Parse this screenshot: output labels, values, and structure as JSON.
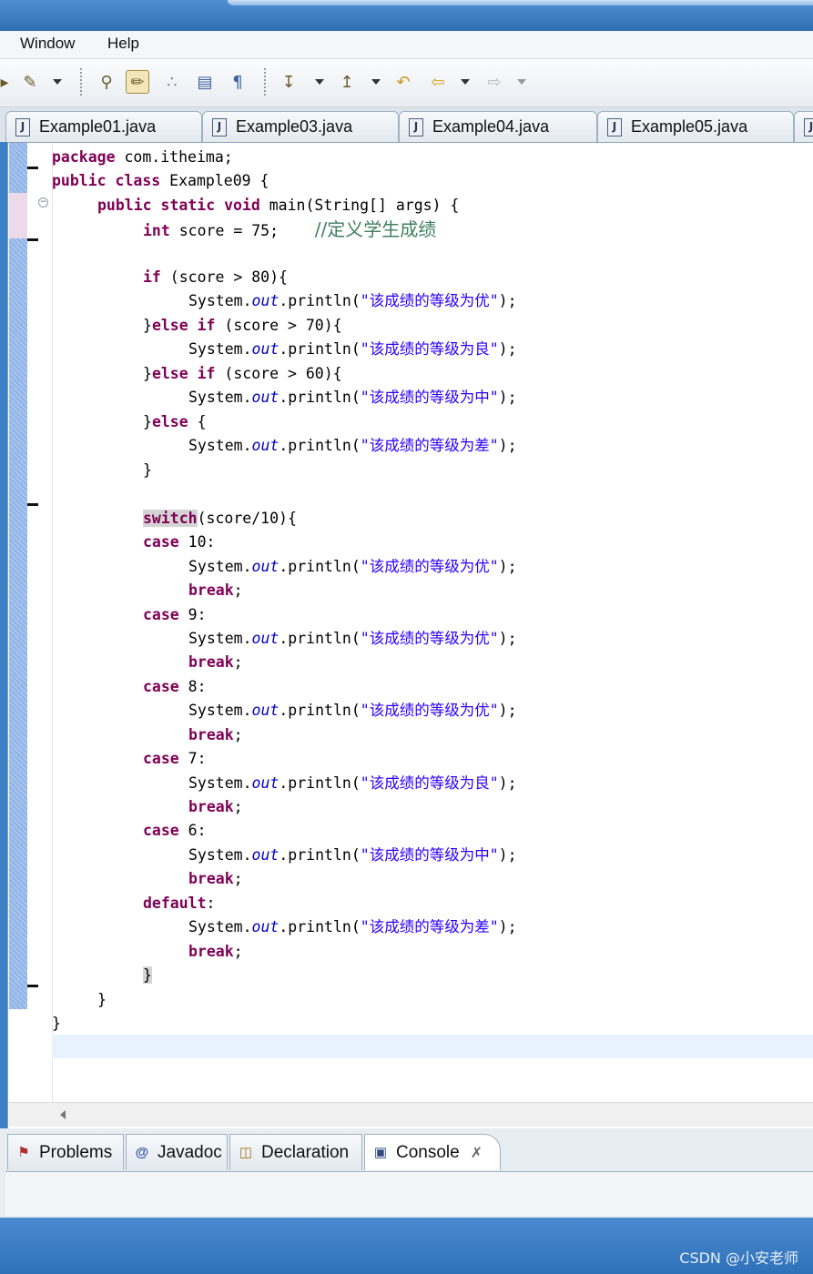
{
  "menubar": {
    "items": [
      "Window",
      "Help"
    ]
  },
  "toolbar": {
    "icons": [
      "brush-icon",
      "search-help-icon",
      "highlight-pen-icon",
      "balls-icon",
      "outline-icon",
      "pilcrow-icon",
      "next-annotation-icon",
      "prev-annotation-icon",
      "last-edit-icon",
      "back-arrow-icon",
      "forward-arrow-icon"
    ]
  },
  "editor_tabs": [
    "Example01.java",
    "Example03.java",
    "Example04.java",
    "Example05.java"
  ],
  "code": {
    "l1": {
      "kw": "package",
      "rest": " com.itheima;"
    },
    "l2": {
      "kw": "public class",
      "rest": " Example09 {"
    },
    "l3": {
      "kw": "public static void",
      "rest": " main(String[] args) {"
    },
    "l4": {
      "kw": "int",
      "rest": " score = 75;    ",
      "comment": "//定义学生成绩"
    },
    "l6": {
      "kw": "if",
      "rest": " (score > 80){"
    },
    "l8": {
      "kw": "else if",
      "rest": " (score > 70){"
    },
    "l10": {
      "kw": "else if",
      "rest": " (score > 60){"
    },
    "l12": {
      "kw": "else",
      "rest": " {"
    },
    "sys": "System.",
    "out": "out",
    "println": ".println(",
    "end": ");",
    "strings": {
      "you": "\"该成绩的等级为优\"",
      "liang": "\"该成绩的等级为良\"",
      "zhong": "\"该成绩的等级为中\"",
      "cha": "\"该成绩的等级为差\""
    },
    "switch_kw": "switch",
    "switch_rest": "(score/10){",
    "case_kw": "case",
    "cases": [
      " 10:",
      " 9:",
      " 8:",
      " 7:",
      " 6:"
    ],
    "default_kw": "default",
    "break_kw": "break",
    "close_brace": "}",
    "open_close_else": "}"
  },
  "bottom_tabs": [
    "Problems",
    "Javadoc",
    "Declaration",
    "Console"
  ],
  "watermark": "CSDN @小安老师",
  "colors": {
    "keyword": "#7f0055",
    "string": "#2a00ff",
    "field": "#0000c0",
    "comment": "#3f7f5f",
    "current_line": "#e8f2fe"
  }
}
